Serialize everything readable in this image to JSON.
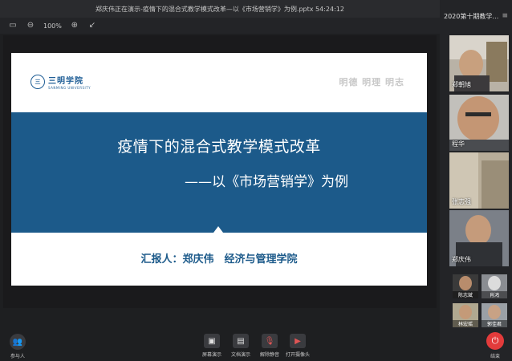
{
  "window": {
    "title": "郑庆伟正在演示-疫情下的混合式教学模式改革—以《市场营销学》为例.pptx 54:24:12"
  },
  "toolbar": {
    "zoom": "100%"
  },
  "slide": {
    "logo_cn": "三明学院",
    "logo_en": "SANMING UNIVERSITY",
    "logo_seal": "三",
    "motto": "明德 明理 明志",
    "title": "疫情下的混合式教学模式改革",
    "subtitle": "——以《市场营销学》为例",
    "reporter": "汇报人：郑庆伟　经济与管理学院",
    "band_color": "#1c5a8a"
  },
  "bottom": {
    "participants": "参与人",
    "screen_share": "屏幕演示",
    "doc_present": "文档演示",
    "unmute": "解除静音",
    "camera": "打开摄像头"
  },
  "panel": {
    "title": "2020第十期教学…",
    "videos": [
      {
        "name": "郑朝旭"
      },
      {
        "name": "程华"
      },
      {
        "name": "张志强"
      },
      {
        "name": "郑庆伟"
      }
    ],
    "thumbs": [
      {
        "name": "陈志斌"
      },
      {
        "name": "肖鸿"
      },
      {
        "name": "林宏瑶"
      },
      {
        "name": "郭佳君"
      }
    ],
    "end_label": "结束"
  }
}
